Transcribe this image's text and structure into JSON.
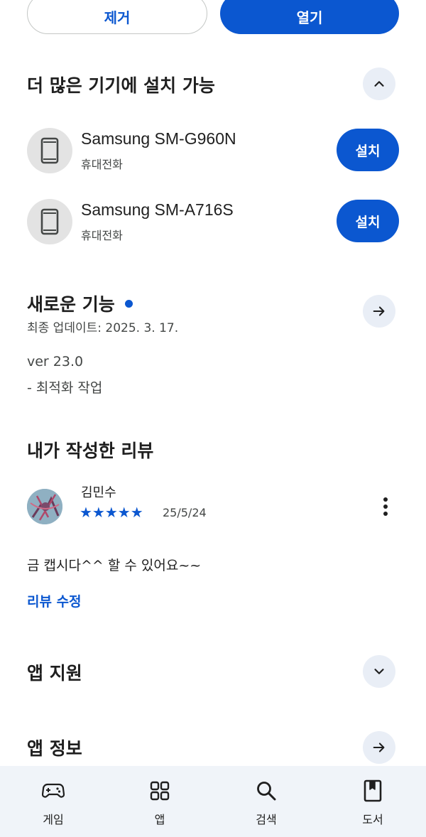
{
  "top_actions": {
    "remove_label": "제거",
    "open_label": "열기"
  },
  "more_devices": {
    "title": "더 많은 기기에 설치 가능",
    "toggle_icon": "chevron-up-icon",
    "devices": [
      {
        "name": "Samsung SM-G960N",
        "type": "휴대전화",
        "install_label": "설치",
        "icon": "phone-icon"
      },
      {
        "name": "Samsung SM-A716S",
        "type": "휴대전화",
        "install_label": "설치",
        "icon": "phone-icon"
      }
    ]
  },
  "whats_new": {
    "title": "새로운 기능",
    "updated": "최종 업데이트: 2025. 3. 17.",
    "version": "ver 23.0",
    "note": "- 최적화 작업",
    "arrow_icon": "arrow-right-icon"
  },
  "my_review": {
    "title": "내가 작성한 리뷰",
    "reviewer": "김민수",
    "rating": 5,
    "stars": "★★★★★",
    "date": "25/5/24",
    "text": "금 캡시다^^ 할 수 있어요~~",
    "edit_label": "리뷰 수정"
  },
  "app_support": {
    "title": "앱 지원",
    "toggle_icon": "chevron-down-icon"
  },
  "app_info": {
    "title": "앱 정보",
    "arrow_icon": "arrow-right-icon"
  },
  "bottom_nav": [
    {
      "label": "게임",
      "icon": "gamepad-icon"
    },
    {
      "label": "앱",
      "icon": "apps-grid-icon"
    },
    {
      "label": "검색",
      "icon": "search-icon"
    },
    {
      "label": "도서",
      "icon": "book-icon"
    }
  ],
  "colors": {
    "accent": "#0b57d0",
    "circle_bg": "#e9eef6",
    "nav_bg": "#f0f4f9"
  }
}
